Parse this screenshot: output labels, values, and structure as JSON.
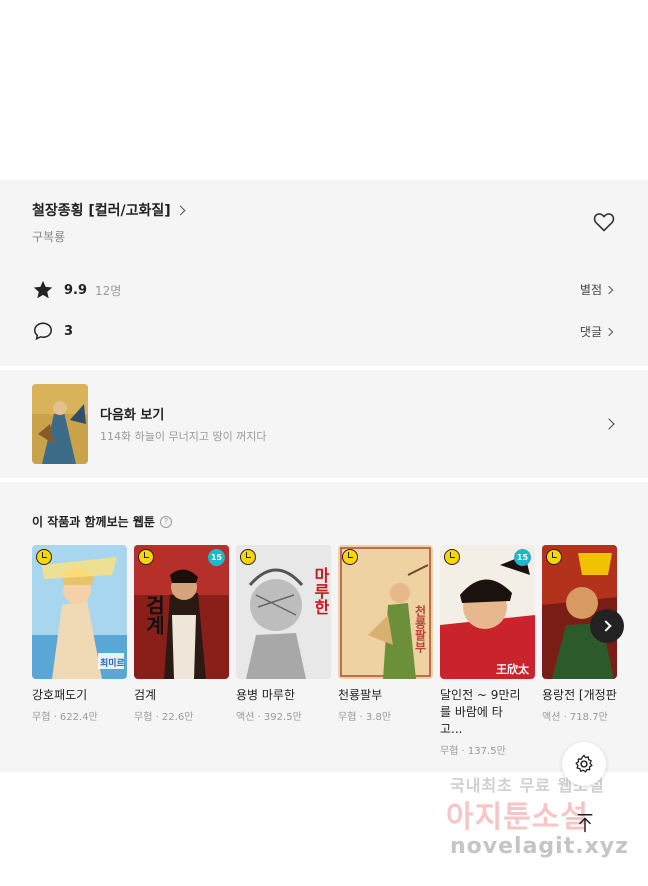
{
  "series": {
    "title": "철장종횡 [컬러/고화질]",
    "author": "구복룡"
  },
  "rating": {
    "score": "9.9",
    "count": "12명",
    "link_label": "별점"
  },
  "comments": {
    "count": "3",
    "link_label": "댓글"
  },
  "next_episode": {
    "title": "다음화 보기",
    "subtitle": "114화 하늘이 무너지고 땅이 꺼지다"
  },
  "recommendations": {
    "heading": "이 작품과 함께보는 웹툰",
    "items": [
      {
        "title": "강호패도기",
        "meta": "무협 · 622.4만",
        "badge": "",
        "cover_text": "최미르"
      },
      {
        "title": "검계",
        "meta": "무협 · 22.6만",
        "badge": "15",
        "cover_text": "검계"
      },
      {
        "title": "용병 마루한",
        "meta": "액션 · 392.5만",
        "badge": "",
        "cover_text": "마루한"
      },
      {
        "title": "천룡팔부",
        "meta": "무협 · 3.8만",
        "badge": "",
        "cover_text": "천룡팔부"
      },
      {
        "title": "달인전 ~ 9만리를 바람에 타고...",
        "meta": "무협 · 137.5만",
        "badge": "15",
        "cover_text": "王欣太"
      },
      {
        "title": "용랑전 [개정판]",
        "meta": "액션 · 718.7만",
        "badge": "",
        "cover_text": ""
      }
    ]
  },
  "watermark": {
    "line1": "국내최초 무료 웹소설",
    "line2": "아지툰소설",
    "line3": "novelagit.xyz"
  },
  "colors": {
    "panel_bg": "#f5f5f5",
    "badge_teal": "#1fb7c9",
    "clock_yellow": "#ffd400"
  }
}
